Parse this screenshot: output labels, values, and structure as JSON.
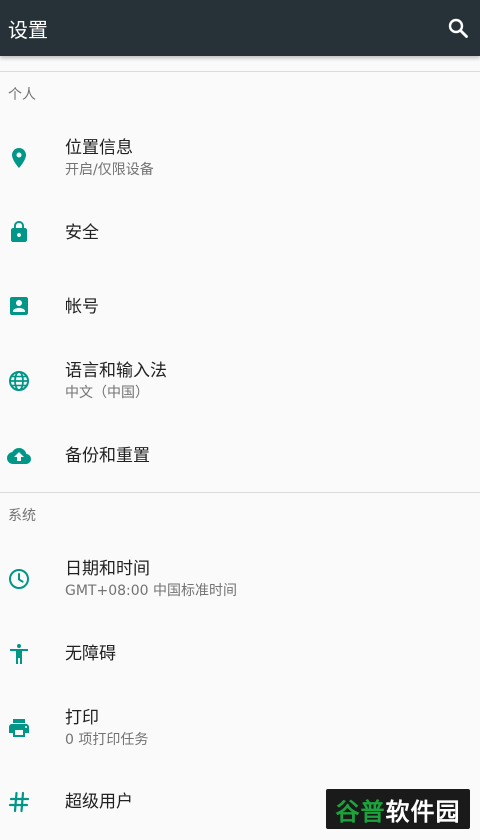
{
  "app": {
    "title": "设置"
  },
  "colors": {
    "toolbar": "#263238",
    "accent": "#009688"
  },
  "sections": [
    {
      "header": "个人",
      "items": [
        {
          "title": "位置信息",
          "summary": "开启/仅限设备",
          "icon": "location-icon"
        },
        {
          "title": "安全",
          "summary": "",
          "icon": "lock-icon"
        },
        {
          "title": "帐号",
          "summary": "",
          "icon": "account-box-icon"
        },
        {
          "title": "语言和输入法",
          "summary": "中文（中国）",
          "icon": "globe-icon"
        },
        {
          "title": "备份和重置",
          "summary": "",
          "icon": "cloud-upload-icon"
        }
      ]
    },
    {
      "header": "系统",
      "items": [
        {
          "title": "日期和时间",
          "summary": "GMT+08:00 中国标准时间",
          "icon": "clock-icon"
        },
        {
          "title": "无障碍",
          "summary": "",
          "icon": "accessibility-icon"
        },
        {
          "title": "打印",
          "summary": "0 项打印任务",
          "icon": "print-icon"
        },
        {
          "title": "超级用户",
          "summary": "",
          "icon": "hash-icon"
        }
      ]
    }
  ],
  "watermark": {
    "part1": "谷普",
    "part2": "软件园"
  }
}
